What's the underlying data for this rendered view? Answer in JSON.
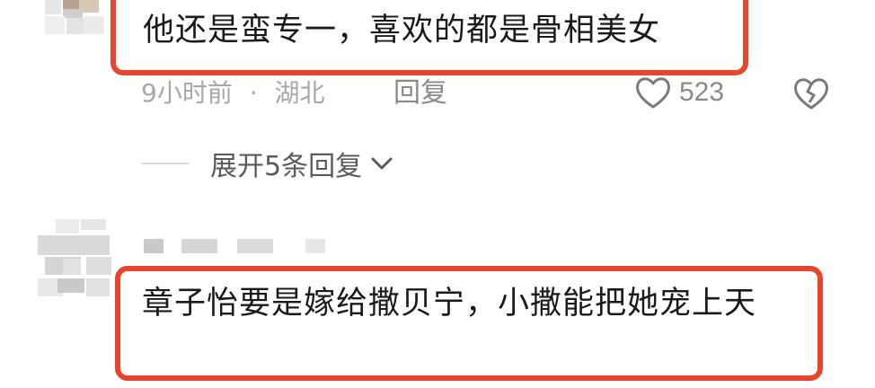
{
  "comment1": {
    "text": "他还是蛮专一，喜欢的都是骨相美女",
    "time": "9小时前",
    "separator": "·",
    "location": "湖北",
    "reply_label": "回复",
    "like_count": "523",
    "expand_label": "展开5条回复"
  },
  "comment2": {
    "text": "章子怡要是嫁给撒贝宁，小撒能把她宠上天"
  },
  "colors": {
    "highlight_border": "#e8452c",
    "meta_gray": "#a8a8a8",
    "text_dark": "#1a1a1a"
  },
  "icons": [
    "heart-icon",
    "broken-heart-icon",
    "chevron-down-icon"
  ]
}
